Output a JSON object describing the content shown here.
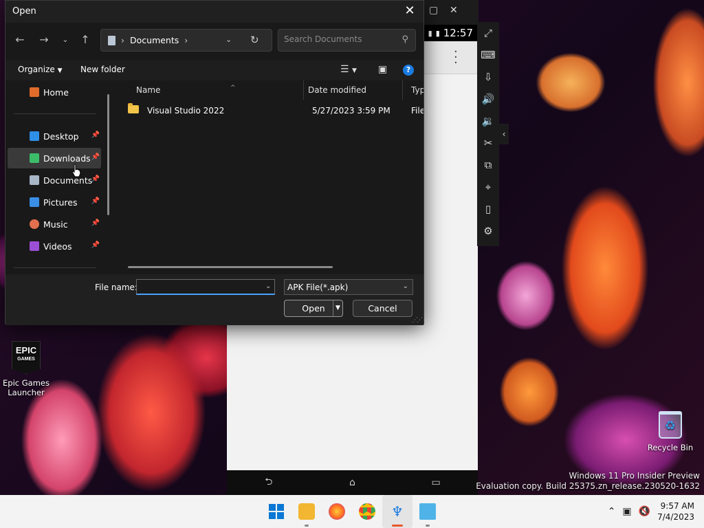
{
  "dialog": {
    "title": "Open",
    "address_segments": [
      "Documents"
    ],
    "search_placeholder": "Search Documents",
    "toolbar": {
      "organize": "Organize",
      "new_folder": "New folder"
    },
    "nav_items": [
      {
        "label": "Home",
        "icon": "home-icon",
        "color": "#e06b2a"
      },
      {
        "label": "Desktop",
        "icon": "desktop-icon",
        "color": "#2f8fe6",
        "pinned": true
      },
      {
        "label": "Downloads",
        "icon": "downloads-icon",
        "color": "#3bbd6a",
        "pinned": true
      },
      {
        "label": "Documents",
        "icon": "documents-icon",
        "color": "#a9b6c8",
        "pinned": true
      },
      {
        "label": "Pictures",
        "icon": "pictures-icon",
        "color": "#3a8ee6",
        "pinned": true
      },
      {
        "label": "Music",
        "icon": "music-icon",
        "color": "#e0704e",
        "pinned": true
      },
      {
        "label": "Videos",
        "icon": "videos-icon",
        "color": "#9b4fd6",
        "pinned": true
      }
    ],
    "columns": {
      "name": "Name",
      "date": "Date modified",
      "type": "Type"
    },
    "files": [
      {
        "name": "Visual Studio 2022",
        "date": "5/27/2023 3:59 PM",
        "type": "File fo"
      }
    ],
    "file_name_label": "File name:",
    "file_name_value": "",
    "file_type": "APK File(*.apk)",
    "open_button": "Open",
    "cancel_button": "Cancel"
  },
  "emulator": {
    "time": "12:57"
  },
  "desktop": {
    "icons": [
      {
        "label_line1": "Epic Games",
        "label_line2": "Launcher",
        "logo_top": "EPIC",
        "logo_bottom": "GAMES"
      },
      {
        "label_line1": "Recycle Bin"
      }
    ],
    "watermark": {
      "line1": "Windows 11 Pro Insider Preview",
      "line2": "Evaluation copy. Build 25375.zn_release.230520-1632"
    }
  },
  "taskbar": {
    "clock_time": "9:57 AM",
    "clock_date": "7/4/2023",
    "accent": "#e8572a"
  }
}
